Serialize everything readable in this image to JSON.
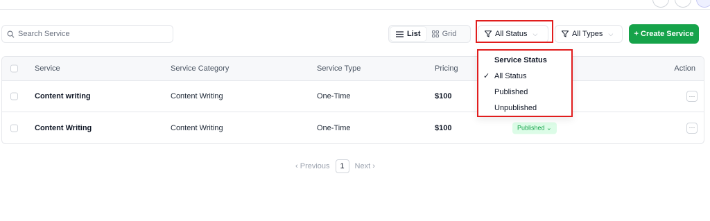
{
  "search": {
    "placeholder": "Search Service"
  },
  "view_toggle": {
    "list_label": "List",
    "grid_label": "Grid"
  },
  "filters": {
    "status_label": "All Status",
    "types_label": "All Types"
  },
  "create_button": {
    "label": "+ Create Service"
  },
  "table": {
    "headers": [
      "Service",
      "Service Category",
      "Service Type",
      "Pricing",
      "Action"
    ],
    "rows": [
      {
        "service": "Content writing",
        "category": "Content Writing",
        "type": "One-Time",
        "pricing": "$100",
        "status": ""
      },
      {
        "service": "Content Writing",
        "category": "Content Writing",
        "type": "One-Time",
        "pricing": "$100",
        "status": "Published"
      }
    ],
    "action_glyph": "···"
  },
  "status_dropdown": {
    "title": "Service Status",
    "options": [
      "All Status",
      "Published",
      "Unpublished"
    ],
    "selected": "All Status"
  },
  "pagination": {
    "prev": "Previous",
    "current": "1",
    "next": "Next"
  },
  "colors": {
    "primary": "#16a34a",
    "highlight": "#e11d1d"
  }
}
